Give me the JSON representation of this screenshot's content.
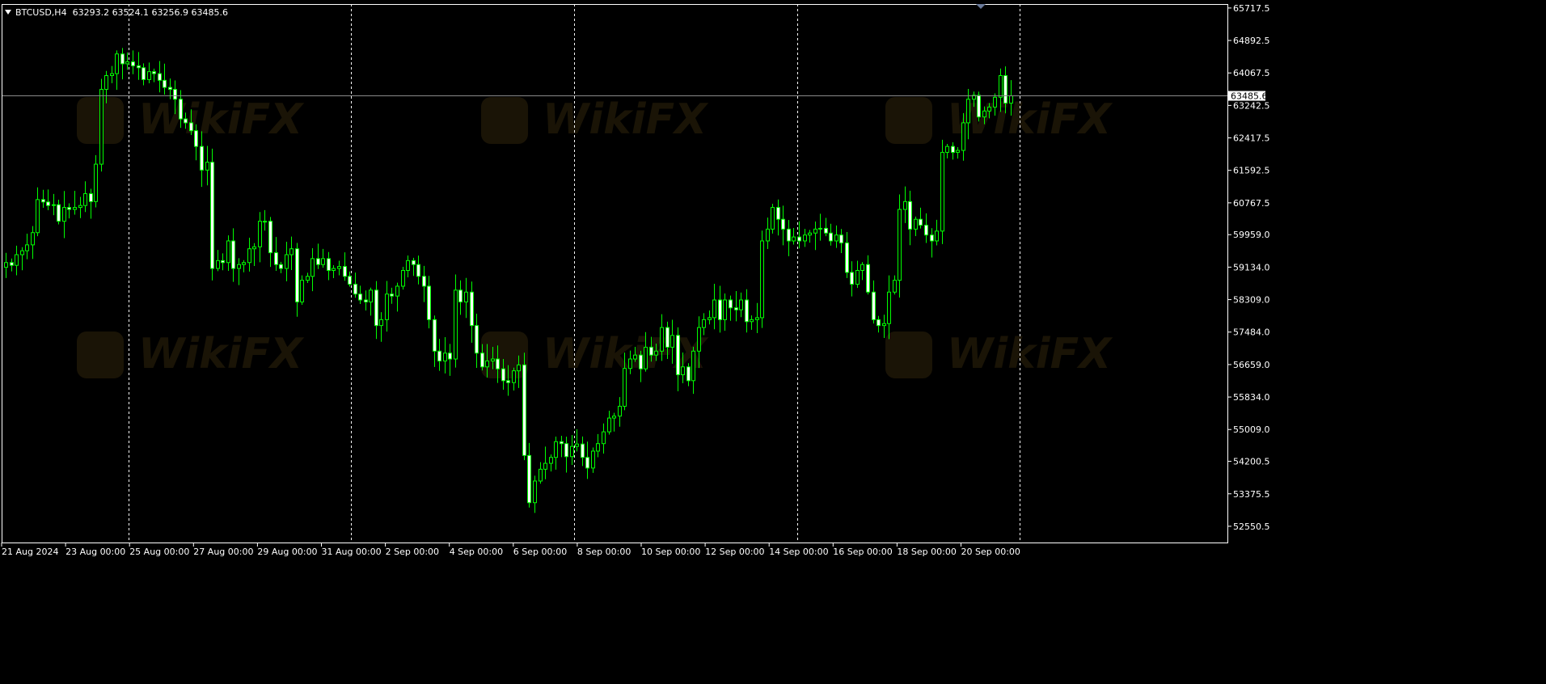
{
  "header": {
    "symbol": "BTCUSD,H4",
    "ohlc": "63293.2 63524.1 63256.9 63485.6"
  },
  "colors": {
    "background": "#000000",
    "bull": "#00ff00",
    "bull_body": "#000000",
    "bear_body": "#ffffff",
    "grid": "#ffffff",
    "axis_text": "#ffffff"
  },
  "watermark": "WikiFX",
  "chart_data": {
    "type": "candlestick",
    "title": "BTCUSD,H4",
    "current_price": 63485.6,
    "ylim": [
      52138,
      65818
    ],
    "y_ticks": [
      "65717.5",
      "64892.5",
      "64067.5",
      "63242.5",
      "62417.5",
      "61592.5",
      "60767.5",
      "59959.0",
      "59134.0",
      "58309.0",
      "57484.0",
      "56659.0",
      "55834.0",
      "55009.0",
      "54200.5",
      "53375.5",
      "52550.5"
    ],
    "x_ticks": [
      "21 Aug 2024",
      "23 Aug 00:00",
      "25 Aug 00:00",
      "27 Aug 00:00",
      "29 Aug 00:00",
      "31 Aug 00:00",
      "2 Sep 00:00",
      "4 Sep 00:00",
      "6 Sep 00:00",
      "8 Sep 00:00",
      "10 Sep 00:00",
      "12 Sep 00:00",
      "14 Sep 00:00",
      "16 Sep 00:00",
      "18 Sep 00:00",
      "20 Sep 00:00"
    ],
    "period_separators": [
      "25 Aug",
      "1 Sep",
      "8 Sep",
      "15 Sep",
      "22 Sep"
    ],
    "grid": false,
    "closes": [
      59250,
      59180,
      59450,
      59550,
      59700,
      60010,
      60850,
      60790,
      60700,
      60720,
      60300,
      60650,
      60600,
      60650,
      60700,
      61000,
      60800,
      61750,
      63650,
      64000,
      64050,
      64550,
      64300,
      64350,
      64250,
      64200,
      63900,
      64100,
      64050,
      63880,
      63700,
      63650,
      63400,
      62900,
      62800,
      62600,
      62200,
      61600,
      61800,
      59100,
      59300,
      59250,
      59800,
      59100,
      59200,
      59250,
      59600,
      59650,
      60300,
      60300,
      59500,
      59200,
      59100,
      59450,
      59600,
      58250,
      58800,
      58900,
      59350,
      59200,
      59350,
      59050,
      59100,
      59150,
      58900,
      58700,
      58450,
      58300,
      58250,
      58550,
      57650,
      57800,
      58450,
      58400,
      58650,
      59050,
      59300,
      59200,
      58900,
      58650,
      57800,
      57000,
      56750,
      56950,
      56800,
      58550,
      58250,
      58500,
      57650,
      56950,
      56600,
      56750,
      56800,
      56550,
      56250,
      56200,
      56500,
      56650,
      54350,
      53150,
      53700,
      54000,
      54150,
      54300,
      54700,
      54650,
      54320,
      54580,
      54640,
      54300,
      54030,
      54460,
      54650,
      54950,
      55300,
      55350,
      55600,
      56560,
      56800,
      56900,
      56550,
      57100,
      56900,
      57000,
      57600,
      57100,
      57400,
      56400,
      56600,
      56250,
      57000,
      57600,
      57800,
      57850,
      58300,
      57800,
      58300,
      58100,
      58050,
      58300,
      57750,
      57800,
      57850,
      59800,
      60100,
      60650,
      60350,
      60100,
      59800,
      59900,
      59800,
      59950,
      60000,
      60100,
      60120,
      60000,
      59800,
      59950,
      59750,
      59000,
      58700,
      59050,
      59200,
      58500,
      57800,
      57650,
      57700,
      58500,
      58800,
      60600,
      60800,
      60100,
      60350,
      60200,
      59950,
      59800,
      60050,
      62050,
      62200,
      62050,
      62100,
      62800,
      63400,
      63500,
      62950,
      63100,
      63200,
      63450,
      64000,
      63300,
      63485.6
    ],
    "series_note": "H4 bars from 21 Aug 2024 to 20 Sep 2024; white-bodied bars close below open, hollow green bars close above open"
  }
}
